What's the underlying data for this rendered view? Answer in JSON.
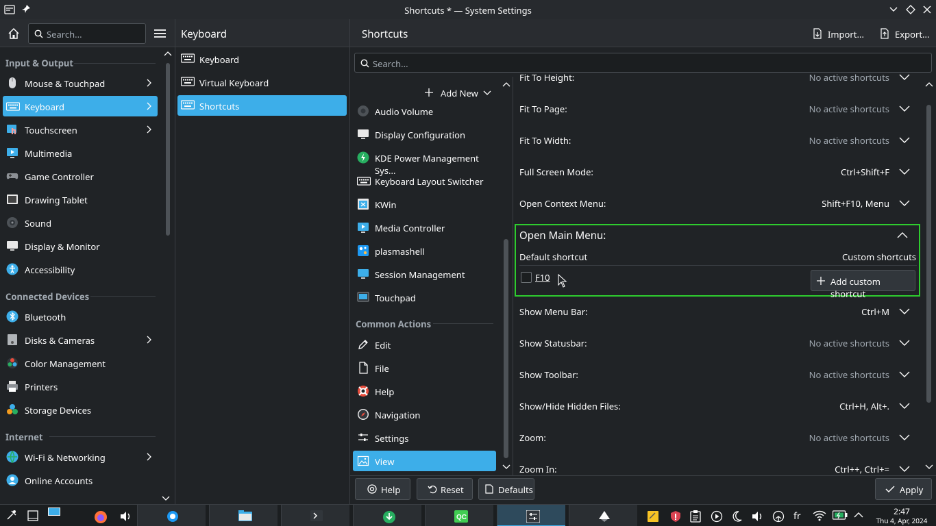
{
  "window": {
    "title": "Shortcuts * — System Settings"
  },
  "sidebar": {
    "search_placeholder": "Search...",
    "categories": [
      {
        "name": "Input & Output",
        "items": [
          {
            "label": "Mouse & Touchpad",
            "icon": "mouse-icon",
            "arrow": true
          },
          {
            "label": "Keyboard",
            "icon": "keyboard-icon",
            "arrow": true,
            "selected": true
          },
          {
            "label": "Touchscreen",
            "icon": "touchscreen-icon",
            "arrow": true
          },
          {
            "label": "Multimedia",
            "icon": "multimedia-icon"
          },
          {
            "label": "Game Controller",
            "icon": "gamepad-icon"
          },
          {
            "label": "Drawing Tablet",
            "icon": "tablet-icon"
          },
          {
            "label": "Sound",
            "icon": "sound-icon"
          },
          {
            "label": "Display & Monitor",
            "icon": "monitor-icon"
          },
          {
            "label": "Accessibility",
            "icon": "accessibility-icon"
          }
        ]
      },
      {
        "name": "Connected Devices",
        "items": [
          {
            "label": "Bluetooth",
            "icon": "bluetooth-icon"
          },
          {
            "label": "Disks & Cameras",
            "icon": "disk-icon",
            "arrow": true
          },
          {
            "label": "Color Management",
            "icon": "color-icon"
          },
          {
            "label": "Printers",
            "icon": "printer-icon"
          },
          {
            "label": "Storage Devices",
            "icon": "storage-icon"
          }
        ]
      },
      {
        "name": "Internet",
        "items": [
          {
            "label": "Wi-Fi & Networking",
            "icon": "wifi-icon",
            "arrow": true
          },
          {
            "label": "Online Accounts",
            "icon": "accounts-icon"
          }
        ]
      }
    ]
  },
  "keyboard_panel": {
    "title": "Keyboard",
    "items": [
      {
        "label": "Keyboard"
      },
      {
        "label": "Virtual Keyboard"
      },
      {
        "label": "Shortcuts",
        "selected": true
      }
    ]
  },
  "shortcuts": {
    "title": "Shortcuts",
    "import_label": "Import...",
    "export_label": "Export...",
    "search_placeholder": "Search...",
    "add_new_label": "Add New",
    "components": [
      {
        "label": "Audio Volume",
        "icon": "audio-icon"
      },
      {
        "label": "Display Configuration",
        "icon": "display-icon"
      },
      {
        "label": "KDE Power Management Sys...",
        "icon": "power-icon"
      },
      {
        "label": "Keyboard Layout Switcher",
        "icon": "keyboard-icon"
      },
      {
        "label": "KWin",
        "icon": "kwin-icon"
      },
      {
        "label": "Media Controller",
        "icon": "media-icon"
      },
      {
        "label": "plasmashell",
        "icon": "plasma-icon"
      },
      {
        "label": "Session Management",
        "icon": "session-icon"
      },
      {
        "label": "Touchpad",
        "icon": "touchpad-icon"
      }
    ],
    "common_actions_heading": "Common Actions",
    "common_actions": [
      {
        "label": "Edit",
        "icon": "pencil-icon"
      },
      {
        "label": "File",
        "icon": "file-icon"
      },
      {
        "label": "Help",
        "icon": "help-icon"
      },
      {
        "label": "Navigation",
        "icon": "compass-icon"
      },
      {
        "label": "Settings",
        "icon": "settings-icon"
      },
      {
        "label": "View",
        "icon": "image-icon",
        "selected": true
      }
    ],
    "rows_top": [
      {
        "name": "Fit To Height:",
        "value": "No active shortcuts",
        "dim": true
      },
      {
        "name": "Fit To Page:",
        "value": "No active shortcuts",
        "dim": true
      },
      {
        "name": "Fit To Width:",
        "value": "No active shortcuts",
        "dim": true
      },
      {
        "name": "Full Screen Mode:",
        "value": "Ctrl+Shift+F"
      },
      {
        "name": "Open Context Menu:",
        "value": "Shift+F10, Menu"
      }
    ],
    "expanded": {
      "name": "Open Main Menu:",
      "default_label": "Default shortcut",
      "custom_label": "Custom shortcuts",
      "default_key": "F10",
      "add_custom_label": "Add custom shortcut"
    },
    "rows_bottom": [
      {
        "name": "Show Menu Bar:",
        "value": "Ctrl+M"
      },
      {
        "name": "Show Statusbar:",
        "value": "No active shortcuts",
        "dim": true
      },
      {
        "name": "Show Toolbar:",
        "value": "No active shortcuts",
        "dim": true
      },
      {
        "name": "Show/Hide Hidden Files:",
        "value": "Ctrl+H, Alt+."
      },
      {
        "name": "Zoom:",
        "value": "No active shortcuts",
        "dim": true
      },
      {
        "name": "Zoom In:",
        "value": "Ctrl++, Ctrl+="
      }
    ]
  },
  "footer": {
    "help_label": "Help",
    "reset_label": "Reset",
    "defaults_label": "Defaults",
    "apply_label": "Apply"
  },
  "taskbar": {
    "clock_time": "2:47",
    "clock_date": "Thu 4, Apr, 2024",
    "keyboard_layout": "fr"
  },
  "colors": {
    "accent": "#3daee9",
    "highlight_border": "#2ecc2e",
    "background": "#202326"
  }
}
